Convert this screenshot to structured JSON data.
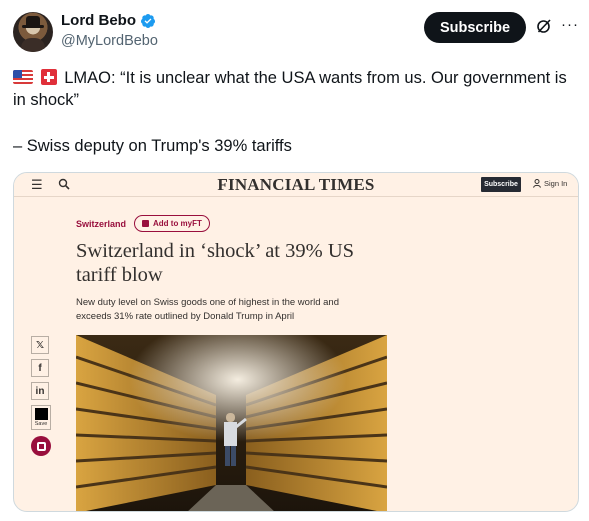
{
  "tweet": {
    "author_name": "Lord Bebo",
    "handle": "@MyLordBebo",
    "subscribe_label": "Subscribe",
    "more_label": "···",
    "text_line1": "LMAO: “It is unclear what the USA wants from us. Our government is in shock”",
    "text_line2": "– Swiss deputy on Trump's 39% tariffs",
    "flags": [
      "us-flag-icon",
      "swiss-flag-icon"
    ]
  },
  "ft": {
    "logo": "FINANCIAL TIMES",
    "subscribe_label": "Subscribe",
    "signin_label": "Sign In",
    "section": "Switzerland",
    "add_label": "Add to myFT",
    "headline": "Switzerland in ‘shock’ at 39% US tariff blow",
    "standfirst": "New duty level on Swiss goods one of highest in the world and exceeds 31% rate outlined by Donald Trump in April",
    "share": {
      "x": "𝕏",
      "facebook": "f",
      "linkedin": "in",
      "save_label": "Save"
    }
  },
  "colors": {
    "ft_background": "#fff1e5",
    "ft_claret": "#990f3d",
    "x_blue": "#1d9bf0",
    "text": "#0f1419",
    "secondary_text": "#536471"
  }
}
